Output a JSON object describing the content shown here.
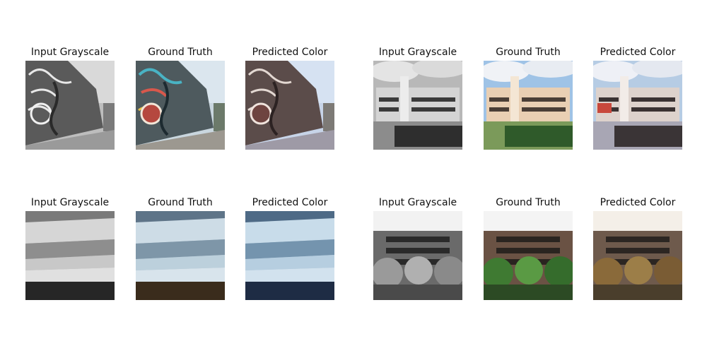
{
  "rows": [
    {
      "samples": [
        {
          "scene": "street mural",
          "panels": [
            {
              "label": "Input Grayscale",
              "mode": "gray"
            },
            {
              "label": "Ground Truth",
              "mode": "truth"
            },
            {
              "label": "Predicted Color",
              "mode": "pred"
            }
          ]
        },
        {
          "scene": "concert hall building",
          "panels": [
            {
              "label": "Input Grayscale",
              "mode": "gray"
            },
            {
              "label": "Ground Truth",
              "mode": "truth"
            },
            {
              "label": "Predicted Color",
              "mode": "pred"
            }
          ]
        }
      ]
    },
    {
      "samples": [
        {
          "scene": "glacier",
          "panels": [
            {
              "label": "Input Grayscale",
              "mode": "gray"
            },
            {
              "label": "Ground Truth",
              "mode": "truth"
            },
            {
              "label": "Predicted Color",
              "mode": "pred"
            }
          ]
        },
        {
          "scene": "apartment with trees",
          "panels": [
            {
              "label": "Input Grayscale",
              "mode": "gray"
            },
            {
              "label": "Ground Truth",
              "mode": "truth"
            },
            {
              "label": "Predicted Color",
              "mode": "pred"
            }
          ]
        }
      ]
    }
  ]
}
